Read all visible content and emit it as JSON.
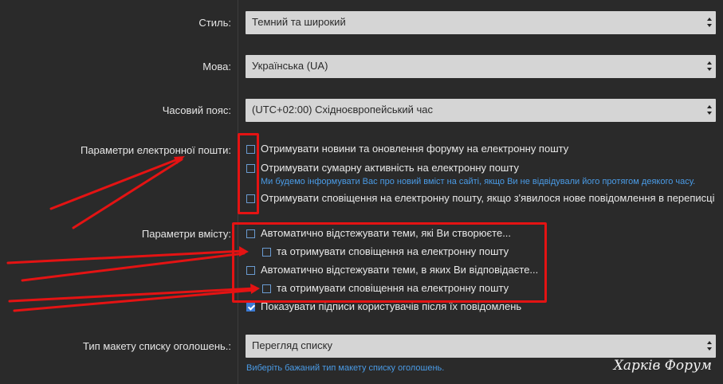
{
  "style": {
    "label": "Стиль:",
    "value": "Темний та широкий"
  },
  "language": {
    "label": "Мова:",
    "value": "Українська (UA)"
  },
  "timezone": {
    "label": "Часовий пояс:",
    "value": "(UTC+02:00) Східноєвропейський час"
  },
  "email_params": {
    "label": "Параметри електронної пошти:",
    "options": [
      {
        "text": "Отримувати новини та оновлення форуму на електронну пошту",
        "checked": false
      },
      {
        "text": "Отримувати сумарну активність на електронну пошту",
        "checked": false,
        "hint": "Ми будемо інформувати Вас про новий вміст на сайті, якщо Ви не відвідували його протягом деякого часу."
      },
      {
        "text": "Отримувати сповіщення на електронну пошту, якщо з'явилося нове повідомлення в переписці",
        "checked": false
      }
    ]
  },
  "content_params": {
    "label": "Параметри вмісту:",
    "options": [
      {
        "text": "Автоматично відстежувати теми, які Ви створюєте...",
        "checked": false
      },
      {
        "text": "та отримувати сповіщення на електронну пошту",
        "checked": false
      },
      {
        "text": "Автоматично відстежувати теми, в яких Ви відповідаєте...",
        "checked": false
      },
      {
        "text": "та отримувати сповіщення на електронну пошту",
        "checked": false
      },
      {
        "text": "Показувати підписи користувачів після їх повідомлень",
        "checked": true
      }
    ]
  },
  "ad_layout": {
    "label": "Тип макету списку оголошень.:",
    "value": "Перегляд списку",
    "hint": "Виберіть бажаний тип макету списку оголошень."
  },
  "watermark": "Харків Форум",
  "colors": {
    "annotation": "#e41313",
    "checkbox_accent": "#3b7bd6",
    "hint": "#4a9be6"
  }
}
